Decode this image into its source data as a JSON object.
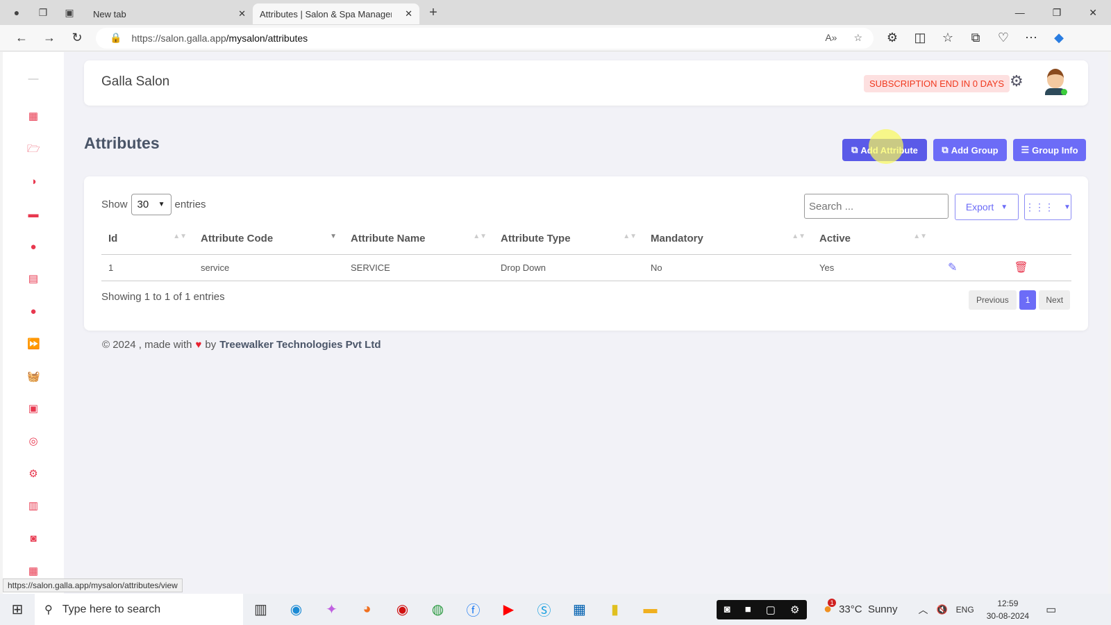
{
  "browser": {
    "tabs": [
      {
        "label": "New tab"
      },
      {
        "label": "Attributes | Salon & Spa Manager"
      }
    ],
    "url_host": "https://salon.galla.app",
    "url_path": "/mysalon/attributes",
    "status_url": "https://salon.galla.app/mysalon/attributes/view"
  },
  "header": {
    "brand": "Galla Salon",
    "subscription": "SUBSCRIPTION END IN 0 DAYS"
  },
  "page": {
    "title": "Attributes",
    "buttons": {
      "add_attribute": "Add Attribute",
      "add_group": "Add Group",
      "group_info": "Group Info"
    }
  },
  "table": {
    "show": "Show",
    "entries_value": "30",
    "entries": "entries",
    "search_placeholder": "Search ...",
    "export": "Export",
    "columns": [
      "Id",
      "Attribute Code",
      "Attribute Name",
      "Attribute Type",
      "Mandatory",
      "Active"
    ],
    "rows": [
      {
        "id": "1",
        "code": "service",
        "name": "SERVICE",
        "type": "Drop Down",
        "mandatory": "No",
        "active": "Yes"
      }
    ],
    "info": "Showing 1 to 1 of 1 entries",
    "prev": "Previous",
    "page": "1",
    "next": "Next"
  },
  "footer": {
    "text": "© 2024 , made with",
    "by": "by",
    "company": "Treewalker Technologies Pvt Ltd"
  },
  "taskbar": {
    "search_placeholder": "Type here to search",
    "weather": "33°C  Sunny",
    "lang": "ENG",
    "time": "12:59",
    "date": "30-08-2024",
    "notification_count": "1"
  },
  "colors": {
    "accent": "#6c6cf7",
    "danger": "#e8384f"
  }
}
